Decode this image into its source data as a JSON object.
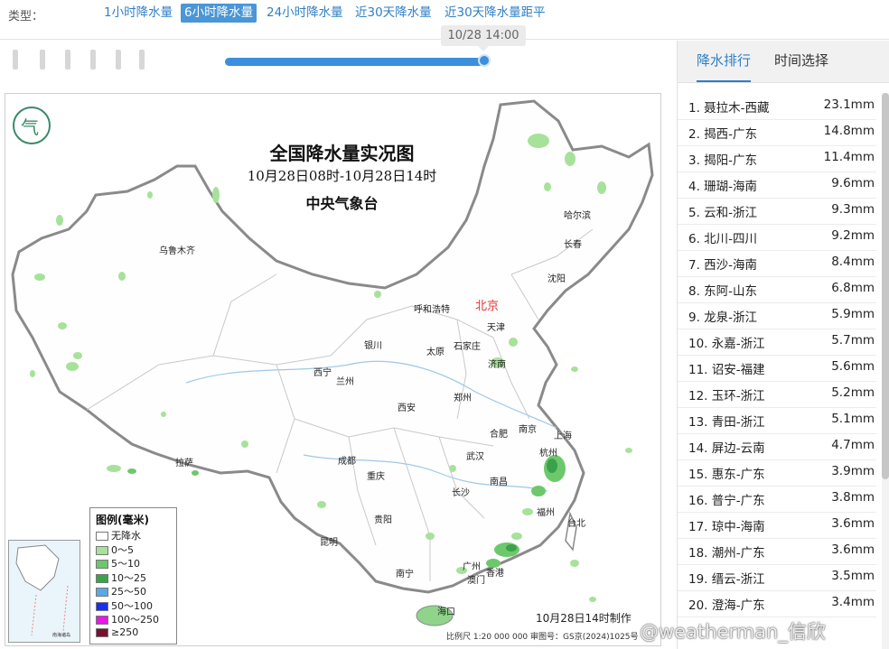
{
  "type_bar": {
    "label": "类型：",
    "tabs": [
      {
        "label": "1小时降水量",
        "active": false
      },
      {
        "label": "6小时降水量",
        "active": true
      },
      {
        "label": "24小时降水量",
        "active": false
      },
      {
        "label": "近30天降水量",
        "active": false
      },
      {
        "label": "近30天降水量距平",
        "active": false
      }
    ]
  },
  "slider": {
    "time_label": "10/28 14:00",
    "position_fraction": 1.0
  },
  "map": {
    "title": "全国降水量实况图",
    "subtitle": "10月28日08时-10月28日14时",
    "agency": "中央气象台",
    "capital": "北京",
    "cities": [
      "乌鲁木齐",
      "哈尔滨",
      "长春",
      "沈阳",
      "呼和浩特",
      "天津",
      "石家庄",
      "太原",
      "银川",
      "济南",
      "西宁",
      "兰州",
      "郑州",
      "西安",
      "合肥",
      "南京",
      "上海",
      "杭州",
      "拉萨",
      "成都",
      "武汉",
      "重庆",
      "长沙",
      "南昌",
      "福州",
      "台北",
      "贵阳",
      "昆明",
      "广州",
      "香港",
      "澳门",
      "南宁",
      "海口"
    ],
    "legend": {
      "title": "图例(毫米)",
      "items": [
        {
          "label": "无降水",
          "color": "#ffffff"
        },
        {
          "label": "0～5",
          "color": "#a6e29a"
        },
        {
          "label": "5～10",
          "color": "#6dc86b"
        },
        {
          "label": "10～25",
          "color": "#3aa34a"
        },
        {
          "label": "25～50",
          "color": "#5aa9e6"
        },
        {
          "label": "50～100",
          "color": "#1a2ff0"
        },
        {
          "label": "100～250",
          "color": "#e619e6"
        },
        {
          "label": "≥250",
          "color": "#7a1030"
        }
      ]
    },
    "inset_label": "南海诸岛",
    "made_time": "10月28日14时制作",
    "scale_note": "比例尺 1:20 000 000    审图号：GS京(2024)1025号"
  },
  "ranking": {
    "tabs": [
      {
        "label": "降水排行",
        "active": true
      },
      {
        "label": "时间选择",
        "active": false
      }
    ],
    "unit": "mm",
    "rows": [
      {
        "rank": "1.",
        "station": "聂拉木-西藏",
        "value": "23.1mm"
      },
      {
        "rank": "2.",
        "station": "揭西-广东",
        "value": "14.8mm"
      },
      {
        "rank": "3.",
        "station": "揭阳-广东",
        "value": "11.4mm"
      },
      {
        "rank": "4.",
        "station": "珊瑚-海南",
        "value": "9.6mm"
      },
      {
        "rank": "5.",
        "station": "云和-浙江",
        "value": "9.3mm"
      },
      {
        "rank": "6.",
        "station": "北川-四川",
        "value": "9.2mm"
      },
      {
        "rank": "7.",
        "station": "西沙-海南",
        "value": "8.4mm"
      },
      {
        "rank": "8.",
        "station": "东阿-山东",
        "value": "6.8mm"
      },
      {
        "rank": "9.",
        "station": "龙泉-浙江",
        "value": "5.9mm"
      },
      {
        "rank": "10.",
        "station": "永嘉-浙江",
        "value": "5.7mm"
      },
      {
        "rank": "11.",
        "station": "诏安-福建",
        "value": "5.6mm"
      },
      {
        "rank": "12.",
        "station": "玉环-浙江",
        "value": "5.2mm"
      },
      {
        "rank": "13.",
        "station": "青田-浙江",
        "value": "5.1mm"
      },
      {
        "rank": "14.",
        "station": "屏边-云南",
        "value": "4.7mm"
      },
      {
        "rank": "15.",
        "station": "惠东-广东",
        "value": "3.9mm"
      },
      {
        "rank": "16.",
        "station": "普宁-广东",
        "value": "3.8mm"
      },
      {
        "rank": "17.",
        "station": "琼中-海南",
        "value": "3.6mm"
      },
      {
        "rank": "18.",
        "station": "潮州-广东",
        "value": "3.6mm"
      },
      {
        "rank": "19.",
        "station": "缙云-浙江",
        "value": "3.5mm"
      },
      {
        "rank": "20.",
        "station": "澄海-广东",
        "value": "3.4mm"
      }
    ]
  },
  "watermark": "@weatherman_信欣"
}
